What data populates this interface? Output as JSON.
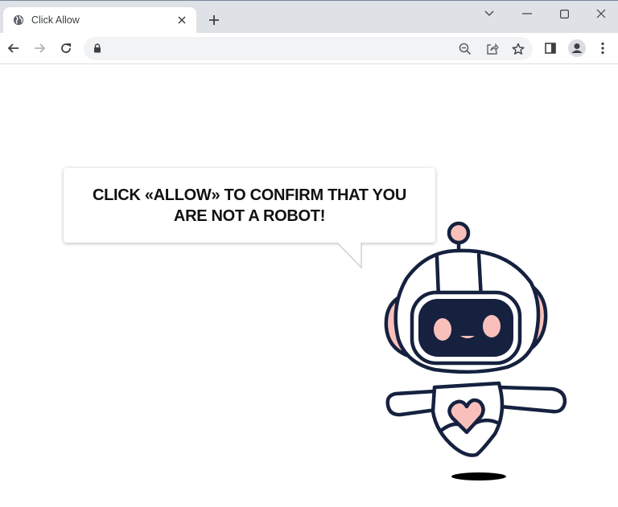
{
  "browser": {
    "tab": {
      "title": "Click Allow",
      "favicon": "globe-icon",
      "close_icon": "close-icon"
    },
    "new_tab_icon": "plus-icon",
    "window_controls": [
      "chevron-down-icon",
      "minimize-icon",
      "maximize-icon",
      "close-icon"
    ],
    "nav": [
      "back-arrow-icon",
      "forward-arrow-icon",
      "reload-icon"
    ],
    "address_bar": {
      "value": "",
      "security_icon": "lock-icon"
    },
    "omnibox_actions": [
      "zoom-icon",
      "share-icon",
      "bookmark-star-icon"
    ],
    "toolbar_actions": [
      "side-panel-icon",
      "profile-avatar-icon",
      "kebab-menu-icon"
    ]
  },
  "page": {
    "bubble": {
      "line1": "CLICK «ALLOW» TO CONFIRM THAT YOU",
      "line2": "ARE NOT A ROBOT!"
    },
    "illustration": "robot-mascot",
    "colors": {
      "navy": "#15213f",
      "pink": "#f9c0bb",
      "text": "#111111"
    }
  }
}
